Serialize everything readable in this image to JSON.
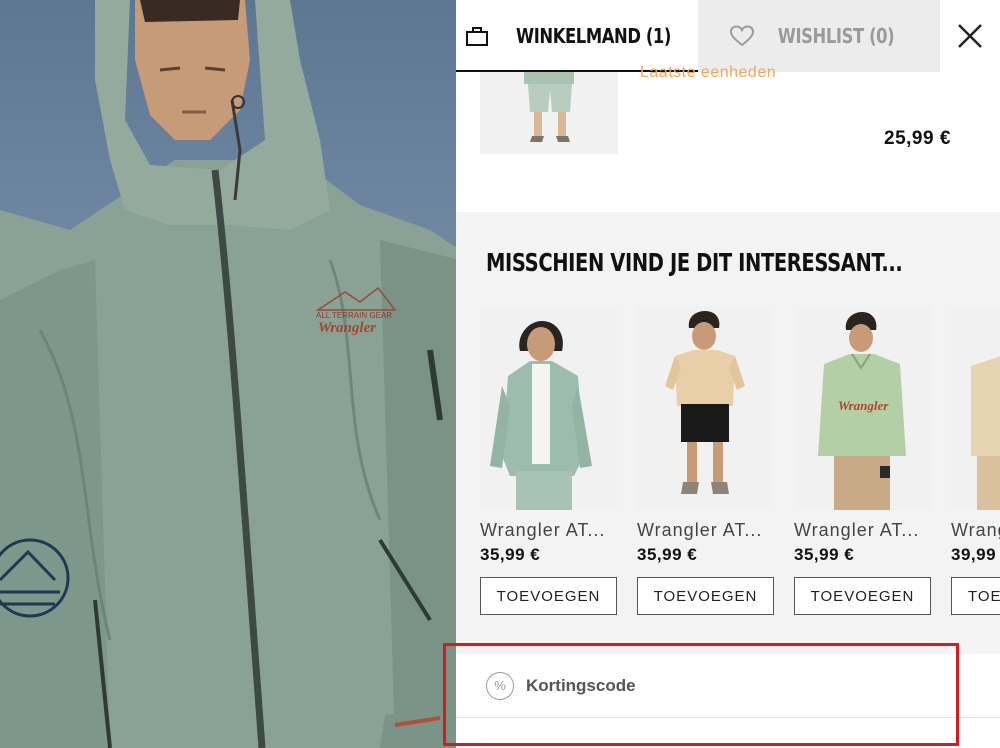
{
  "tabs": {
    "cart_label": "WINKELMAND (1)",
    "wishlist_label": "WISHLIST (0)"
  },
  "cart": {
    "stock_note": "Laatste eenheden",
    "price": "25,99 €"
  },
  "recommendations": {
    "title": "MISSCHIEN VIND JE DIT INTERESSANT...",
    "items": [
      {
        "name": "Wrangler AT...",
        "price": "35,99 €",
        "button": "TOEVOEGEN"
      },
      {
        "name": "Wrangler AT...",
        "price": "35,99 €",
        "button": "TOEVOEGEN"
      },
      {
        "name": "Wrangler AT...",
        "price": "35,99 €",
        "button": "TOEVOEGEN"
      },
      {
        "name": "Wrang",
        "price": "39,99",
        "button": "TOE"
      }
    ]
  },
  "discount": {
    "icon_symbol": "%",
    "label": "Kortingscode"
  },
  "hero": {
    "jacket_logo_text": "Wrangler",
    "jacket_logo_subtext": "ALL TERRAIN GEAR"
  },
  "colors": {
    "accent_orange": "#f2a65a",
    "highlight_red": "#d41c1c",
    "jacket_green": "#8aa295"
  },
  "icons": {
    "cart_tab": "shopping-bag-icon",
    "wishlist_tab": "heart-icon",
    "close": "close-icon",
    "discount": "percent-icon"
  }
}
